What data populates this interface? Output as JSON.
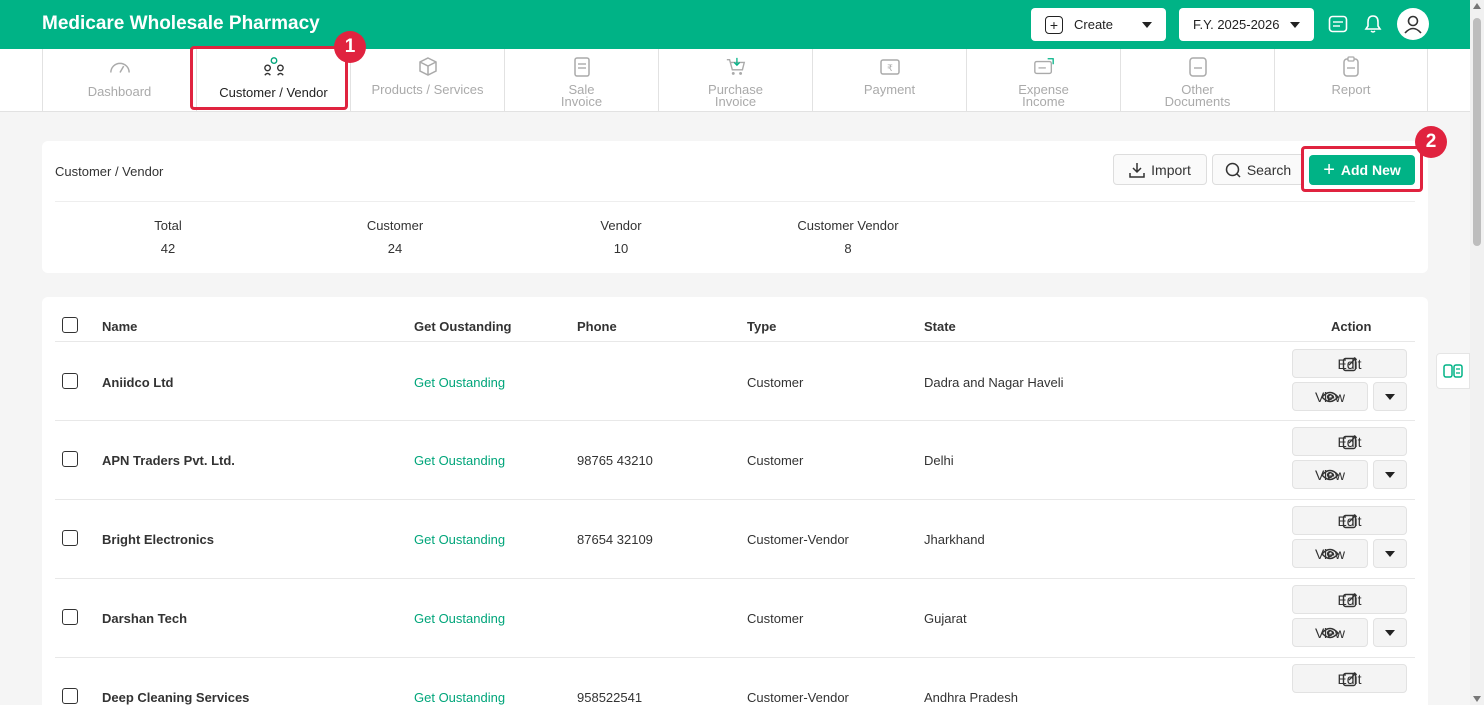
{
  "header": {
    "brand": "Medicare Wholesale Pharmacy",
    "create_label": "Create",
    "fy_label": "F.Y. 2025-2026",
    "accent_color": "#00b386"
  },
  "nav": {
    "tabs": [
      {
        "label": "Dashboard",
        "icon": "gauge-icon"
      },
      {
        "label": "Customer / Vendor",
        "icon": "users-icon",
        "active": true
      },
      {
        "label": "Products / Services",
        "icon": "box-icon"
      },
      {
        "label": "Sale",
        "label2": "Invoice",
        "icon": "sale-invoice-icon"
      },
      {
        "label": "Purchase",
        "label2": "Invoice",
        "icon": "cart-icon"
      },
      {
        "label": "Payment",
        "icon": "payment-icon"
      },
      {
        "label": "Expense",
        "label2": "Income",
        "icon": "expense-icon"
      },
      {
        "label": "Other",
        "label2": "Documents",
        "icon": "document-icon"
      },
      {
        "label": "Report",
        "icon": "report-icon"
      }
    ]
  },
  "annotations": {
    "badge1": "1",
    "badge2": "2",
    "highlight_color": "#e0233f"
  },
  "summary": {
    "title": "Customer / Vendor",
    "import_label": "Import",
    "search_label": "Search",
    "add_label": "Add New",
    "stats": [
      {
        "label": "Total",
        "value": "42"
      },
      {
        "label": "Customer",
        "value": "24"
      },
      {
        "label": "Vendor",
        "value": "10"
      },
      {
        "label": "Customer Vendor",
        "value": "8"
      }
    ]
  },
  "table": {
    "headers": {
      "name": "Name",
      "outstanding": "Get Oustanding",
      "phone": "Phone",
      "type": "Type",
      "state": "State",
      "action": "Action"
    },
    "edit_label": "Edit",
    "view_label": "View",
    "rows": [
      {
        "name": "Aniidco Ltd",
        "outstanding": "Get Oustanding",
        "phone": "",
        "type": "Customer",
        "state": "Dadra and Nagar Haveli"
      },
      {
        "name": "APN Traders Pvt. Ltd.",
        "outstanding": "Get Oustanding",
        "phone": "98765 43210",
        "type": "Customer",
        "state": "Delhi"
      },
      {
        "name": "Bright Electronics",
        "outstanding": "Get Oustanding",
        "phone": "87654 32109",
        "type": "Customer-Vendor",
        "state": "Jharkhand"
      },
      {
        "name": "Darshan Tech",
        "outstanding": "Get Oustanding",
        "phone": "",
        "type": "Customer",
        "state": "Gujarat"
      },
      {
        "name": "Deep Cleaning Services",
        "outstanding": "Get Oustanding",
        "phone": "958522541",
        "type": "Customer-Vendor",
        "state": "Andhra Pradesh"
      }
    ]
  }
}
